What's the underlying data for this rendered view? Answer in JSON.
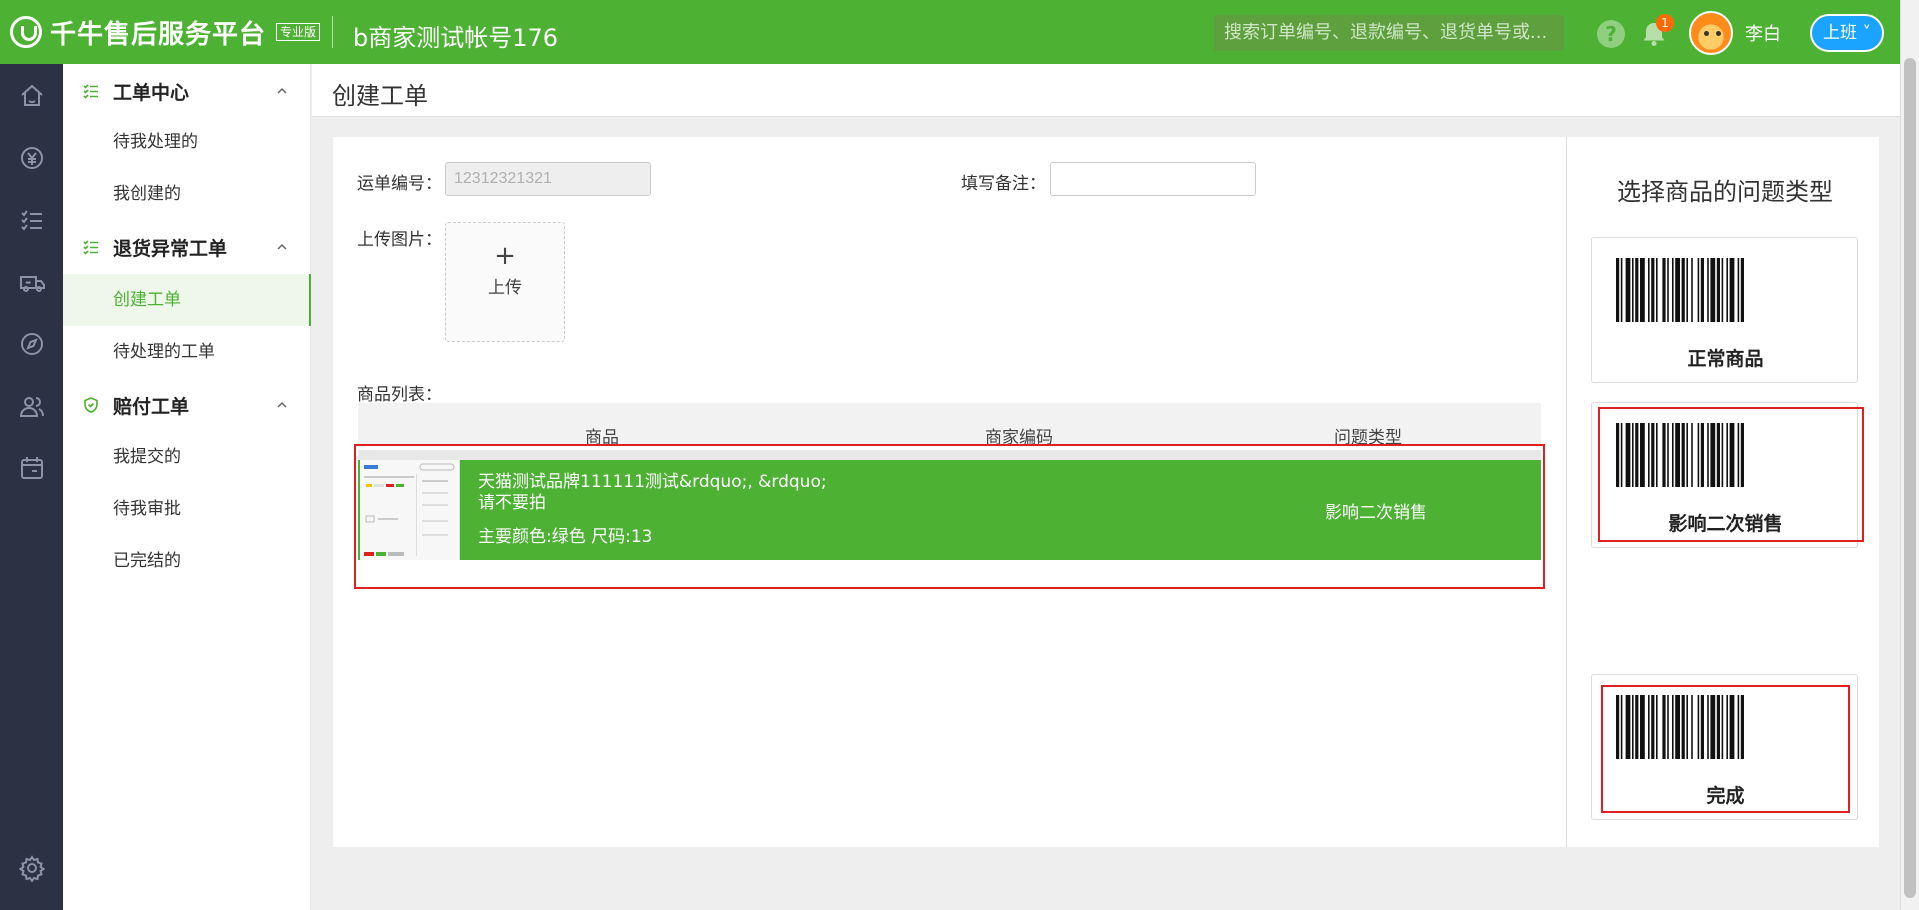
{
  "header": {
    "brand_title": "千牛售后服务平台",
    "brand_edition": "专业版",
    "account_name": "b商家测试帐号176",
    "search_placeholder": "搜索订单编号、退款编号、退货单号或...",
    "help_icon": "help-icon",
    "notification_count": "1",
    "user_name": "李白",
    "shift_button": "上班"
  },
  "rail": {
    "icons": [
      "home-icon",
      "money-icon",
      "list-icon",
      "truck-icon",
      "compass-icon",
      "users-icon",
      "calendar-icon",
      "settings-icon"
    ]
  },
  "sidebar": {
    "groups": [
      {
        "title": "工单中心",
        "items": [
          {
            "label": "待我处理的"
          },
          {
            "label": "我创建的"
          }
        ]
      },
      {
        "title": "退货异常工单",
        "items": [
          {
            "label": "创建工单",
            "active": true
          },
          {
            "label": "待处理的工单"
          }
        ]
      },
      {
        "title": "赔付工单",
        "items": [
          {
            "label": "我提交的"
          },
          {
            "label": "待我审批"
          },
          {
            "label": "已完结的"
          }
        ]
      }
    ]
  },
  "page": {
    "title": "创建工单"
  },
  "form": {
    "waybill_label": "运单编号：",
    "waybill_value": "12312321321",
    "remark_label": "填写备注：",
    "remark_value": "",
    "upload_label": "上传图片：",
    "upload_plus": "+",
    "upload_text": "上传",
    "list_label": "商品列表："
  },
  "table": {
    "columns": [
      "商品",
      "商家编码",
      "问题类型"
    ],
    "rows": [
      {
        "name_line1": "天猫测试品牌111111测试&rdquo;, &rdquo;",
        "name_line2": "请不要拍",
        "spec": "主要颜色:绿色 尺码:13",
        "merchant_code": "",
        "issue_type": "影响二次销售"
      }
    ]
  },
  "issue_panel": {
    "title": "选择商品的问题类型",
    "options": [
      {
        "label": "正常商品"
      },
      {
        "label": "影响二次销售"
      },
      {
        "label": "完成"
      }
    ]
  },
  "colors": {
    "brand_green": "#4db133",
    "rail_bg": "#2b3244",
    "highlight_red": "#e02020",
    "shift_blue": "#1aa3ff"
  }
}
